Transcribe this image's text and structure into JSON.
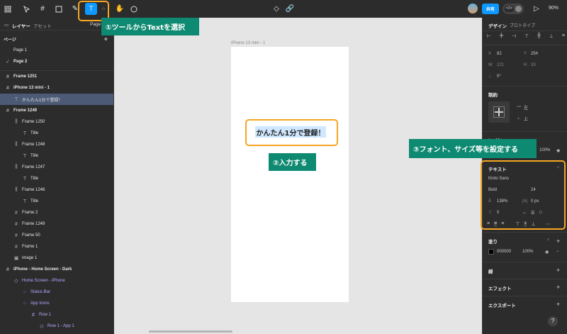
{
  "toolbar": {
    "pages_label": "Page",
    "share_label": "共有",
    "code_toggle_label": "</>",
    "zoom": "90%"
  },
  "left_panel": {
    "tab_layers": "レイヤー",
    "tab_assets": "アセット",
    "pages_header": "ページ",
    "pages": [
      {
        "label": "Page 1",
        "checked": false
      },
      {
        "label": "Page 2",
        "checked": true
      }
    ],
    "layers": [
      {
        "label": "Frame 1251",
        "icon": "frame-icon",
        "indent": 0,
        "bold": true
      },
      {
        "label": "iPhone 13 mini - 1",
        "icon": "frame-icon",
        "indent": 0,
        "bold": true
      },
      {
        "label": "かんたん1分で登録！",
        "icon": "text-icon",
        "indent": 1,
        "selected": true
      },
      {
        "label": "Frame 1249",
        "icon": "frame-icon",
        "indent": 0,
        "bold": true
      },
      {
        "label": "Frame 1250",
        "icon": "autolayout-icon",
        "indent": 1
      },
      {
        "label": "Title",
        "icon": "text-icon",
        "indent": 2
      },
      {
        "label": "Frame 1248",
        "icon": "autolayout-icon",
        "indent": 1
      },
      {
        "label": "Title",
        "icon": "text-icon",
        "indent": 2
      },
      {
        "label": "Frame 1247",
        "icon": "autolayout-icon",
        "indent": 1
      },
      {
        "label": "Title",
        "icon": "text-icon",
        "indent": 2
      },
      {
        "label": "Frame 1246",
        "icon": "autolayout-icon",
        "indent": 1
      },
      {
        "label": "Title",
        "icon": "text-icon",
        "indent": 2
      },
      {
        "label": "Frame 2",
        "icon": "frame-icon",
        "indent": 1
      },
      {
        "label": "Frame 1249",
        "icon": "frame-icon",
        "indent": 1
      },
      {
        "label": "Frame 50",
        "icon": "frame-icon",
        "indent": 1
      },
      {
        "label": "Frame 1",
        "icon": "frame-icon",
        "indent": 1
      },
      {
        "label": "image 1",
        "icon": "image-icon",
        "indent": 1
      },
      {
        "label": "iPhone - Home Screen - Dark",
        "icon": "frame-icon",
        "indent": 0,
        "bold": true
      },
      {
        "label": "Home Screen - iPhone",
        "icon": "component-icon",
        "indent": 1,
        "purple": true
      },
      {
        "label": "Status Bar",
        "icon": "instance-icon",
        "indent": 2,
        "purple": true
      },
      {
        "label": "App Icons",
        "icon": "instance-icon",
        "indent": 2,
        "purple": true
      },
      {
        "label": "Row 1",
        "icon": "frame-icon",
        "indent": 3,
        "purple": true
      },
      {
        "label": "Row 1 - App 1",
        "icon": "component-icon",
        "indent": 4,
        "purple": true
      }
    ]
  },
  "canvas": {
    "frame_label": "iPhone 13 mini - 1",
    "text_content": "かんたん1分で登録！"
  },
  "annotations": {
    "step1": "①ツールからTextを選択",
    "step2": "②入力する",
    "step3": "③フォント、サイズ等を設定する",
    "color_callout": "#0f8a72",
    "color_highlight": "#f5a623"
  },
  "right_panel": {
    "tab_design": "デザイン",
    "tab_prototype": "プロトタイプ",
    "x_label": "X",
    "x_value": "82",
    "y_label": "Y",
    "y_value": "254",
    "w_label": "W",
    "w_value": "221",
    "h_label": "H",
    "h_value": "33",
    "rotation_value": "0°",
    "constraints_header": "制約",
    "constraint_h": "左",
    "constraint_v": "上",
    "layer_header": "レイヤ",
    "layer_opacity": "100%",
    "text_header": "テキスト",
    "font_family": "Kinto Sans",
    "font_weight": "Bold",
    "font_size": "24",
    "line_height": "138%",
    "letter_spacing": "0 px",
    "paragraph_spacing": "0",
    "fill_header": "塗り",
    "fill_hex": "000000",
    "fill_opacity": "100%",
    "stroke_header": "線",
    "effects_header": "エフェクト",
    "export_header": "エクスポート"
  },
  "help_label": "?"
}
